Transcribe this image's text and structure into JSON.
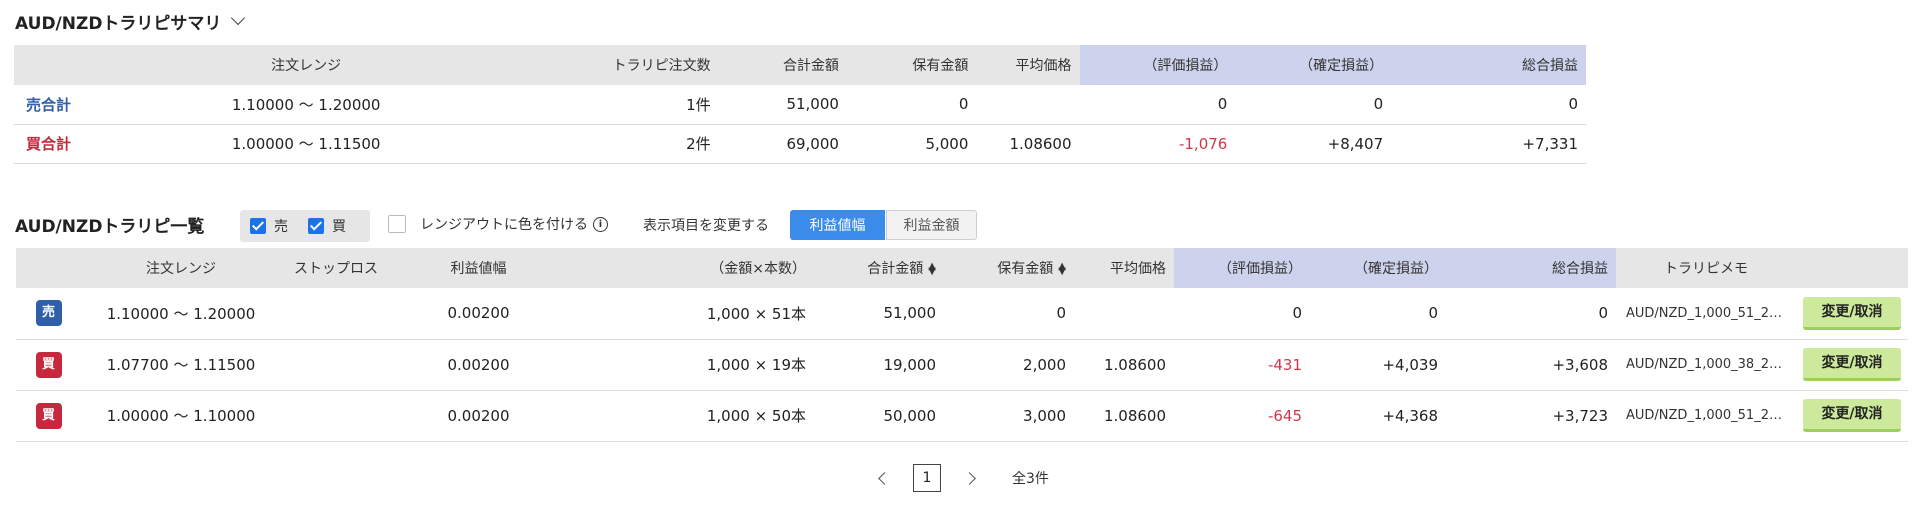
{
  "summary": {
    "title": "AUD/NZDトラリピサマリ",
    "headers": [
      "注文レンジ",
      "トラリピ注文数",
      "合計金額",
      "保有金額",
      "平均価格",
      "（評価損益）",
      "（確定損益）",
      "総合損益"
    ],
    "rows": [
      {
        "label": "売合計",
        "range": "1.10000 〜 1.20000",
        "count": "1件",
        "total": "51,000",
        "held": "0",
        "avg": "",
        "unrealized": "0",
        "realized": "0",
        "net": "0"
      },
      {
        "label": "買合計",
        "range": "1.00000 〜 1.11500",
        "count": "2件",
        "total": "69,000",
        "held": "5,000",
        "avg": "1.08600",
        "unrealized": "-1,076",
        "realized": "+8,407",
        "net": "+7,331"
      }
    ]
  },
  "list": {
    "title": "AUD/NZDトラリピ一覧",
    "filter_sell": "売",
    "filter_buy": "買",
    "range_color_label": "レンジアウトに色を付ける",
    "info_icon": "i",
    "change_items_label": "表示項目を変更する",
    "toggle_profit_width": "利益値幅",
    "toggle_profit_amount": "利益金額",
    "headers": [
      "注文レンジ",
      "ストップロス",
      "利益値幅",
      "（金額×本数）",
      "合計金額",
      "保有金額",
      "平均価格",
      "（評価損益）",
      "（確定損益）",
      "総合損益",
      "トラリピメモ"
    ],
    "action_label": "変更/取消",
    "rows": [
      {
        "side": "売",
        "range": "1.10000 〜 1.20000",
        "stop": "",
        "width": "0.00200",
        "qty": "1,000 × 51本",
        "total": "51,000",
        "held": "0",
        "avg": "",
        "unrealized": "0",
        "realized": "0",
        "net": "0",
        "memo": "AUD/NZD_1,000_51_2…"
      },
      {
        "side": "買",
        "range": "1.07700 〜 1.11500",
        "stop": "",
        "width": "0.00200",
        "qty": "1,000 × 19本",
        "total": "19,000",
        "held": "2,000",
        "avg": "1.08600",
        "unrealized": "-431",
        "realized": "+4,039",
        "net": "+3,608",
        "memo": "AUD/NZD_1,000_38_2…"
      },
      {
        "side": "買",
        "range": "1.00000 〜 1.10000",
        "stop": "",
        "width": "0.00200",
        "qty": "1,000 × 50本",
        "total": "50,000",
        "held": "3,000",
        "avg": "1.08600",
        "unrealized": "-645",
        "realized": "+4,368",
        "net": "+3,723",
        "memo": "AUD/NZD_1,000_51_2…"
      }
    ]
  },
  "pagination": {
    "current": "1",
    "total": "全3件"
  },
  "colors": {
    "accent": "#3b8bea",
    "sell": "#2f5fa8",
    "buy": "#c8283e",
    "negative": "#d0374a",
    "header_highlight": "#cdd3ec",
    "action_button": "#cde99c"
  }
}
